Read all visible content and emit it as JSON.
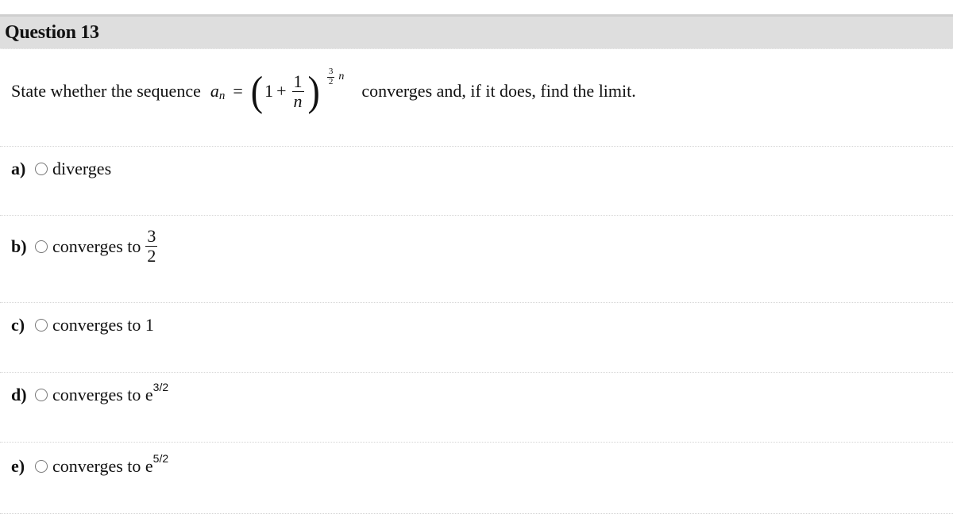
{
  "header": {
    "title": "Question 13"
  },
  "stem": {
    "prefix": "State whether the sequence",
    "formula": {
      "var": "a",
      "sub": "n",
      "equals": "=",
      "open_paren": "(",
      "one": "1",
      "plus": "+",
      "frac_num": "1",
      "frac_den": "n",
      "close_paren": ")",
      "exp_num": "3",
      "exp_den": "2",
      "exp_var": "n"
    },
    "suffix": "converges and, if it does, find the limit."
  },
  "options": [
    {
      "letter": "a)",
      "text": "diverges"
    },
    {
      "letter": "b)",
      "text": "converges to",
      "frac_num": "3",
      "frac_den": "2"
    },
    {
      "letter": "c)",
      "text": "converges to 1"
    },
    {
      "letter": "d)",
      "text": "converges to e",
      "sup": "3/2"
    },
    {
      "letter": "e)",
      "text": "converges to e",
      "sup": "5/2"
    }
  ]
}
